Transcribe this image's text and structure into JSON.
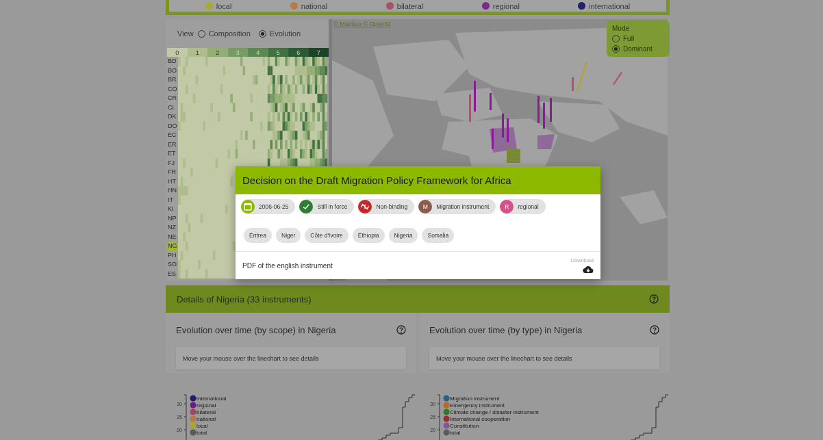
{
  "legend": [
    {
      "label": "local",
      "color": "#a8a832"
    },
    {
      "label": "national",
      "color": "#b87b45"
    },
    {
      "label": "bilateral",
      "color": "#a8506a"
    },
    {
      "label": "regional",
      "color": "#7a2a8a"
    },
    {
      "label": "international",
      "color": "#23236e"
    }
  ],
  "view": {
    "label": "View",
    "options": [
      {
        "label": "Composition",
        "selected": false
      },
      {
        "label": "Evolution",
        "selected": true
      }
    ]
  },
  "heatmap": {
    "scale": [
      {
        "label": "0",
        "color": "#c2c9a6"
      },
      {
        "label": "1",
        "color": "#adbd8c"
      },
      {
        "label": "2",
        "color": "#93ae74"
      },
      {
        "label": "3",
        "color": "#779b62"
      },
      {
        "label": "4",
        "color": "#5c8852"
      },
      {
        "label": "5",
        "color": "#407143"
      },
      {
        "label": "6",
        "color": "#2b5b34"
      },
      {
        "label": "7",
        "color": "#1b4325"
      }
    ],
    "rows": [
      {
        "code": "BD",
        "selected": false
      },
      {
        "code": "BO",
        "selected": false
      },
      {
        "code": "BR",
        "selected": false
      },
      {
        "code": "CO",
        "selected": false
      },
      {
        "code": "CR",
        "selected": false
      },
      {
        "code": "CI",
        "selected": false
      },
      {
        "code": "DK",
        "selected": false
      },
      {
        "code": "DO",
        "selected": false
      },
      {
        "code": "EC",
        "selected": false
      },
      {
        "code": "ER",
        "selected": false
      },
      {
        "code": "ET",
        "selected": false
      },
      {
        "code": "FJ",
        "selected": false
      },
      {
        "code": "FR",
        "selected": false
      },
      {
        "code": "HT",
        "selected": false
      },
      {
        "code": "HN",
        "selected": false
      },
      {
        "code": "IT",
        "selected": false
      },
      {
        "code": "KI",
        "selected": false
      },
      {
        "code": "NP",
        "selected": false
      },
      {
        "code": "NZ",
        "selected": false
      },
      {
        "code": "NE",
        "selected": false
      },
      {
        "code": "NG",
        "selected": true
      },
      {
        "code": "PH",
        "selected": false
      },
      {
        "code": "SO",
        "selected": false
      },
      {
        "code": "ES",
        "selected": false
      }
    ]
  },
  "map": {
    "attribution": "© Mapbox © OpenSt",
    "mode": {
      "label": "Mode",
      "options": [
        {
          "label": "Full",
          "selected": false
        },
        {
          "label": "Dominant",
          "selected": true
        }
      ]
    }
  },
  "dialog": {
    "title": "Decision on the Draft Migration Policy Framework for Africa",
    "chips": [
      {
        "kind": "date",
        "label": "2006-06-25",
        "color": "#8cb800"
      },
      {
        "kind": "status",
        "label": "Still in force",
        "color": "#2e7d32"
      },
      {
        "kind": "binding",
        "label": "Non-binding",
        "color": "#c62828"
      },
      {
        "kind": "letter",
        "letter": "M",
        "label": "Migration instrument",
        "color": "#8d5b4c"
      },
      {
        "kind": "letter",
        "letter": "R",
        "label": "regional",
        "color": "#d6508a"
      }
    ],
    "countries": [
      "Eritrea",
      "Niger",
      "Côte d'Ivoire",
      "Ethiopia",
      "Nigeria",
      "Somalia"
    ],
    "document": "PDF of the english instrument",
    "download": "Download"
  },
  "details": {
    "title": "Details of Nigeria (33 instruments)",
    "panels": [
      {
        "title": "Evolution over time (by scope) in Nigeria",
        "hint": "Move your mouse over the linechart to see details",
        "yticks": [
          "30",
          "25",
          "20"
        ],
        "legend": [
          {
            "label": "international",
            "color": "#1c1c6a"
          },
          {
            "label": "regional",
            "color": "#6a1e8a"
          },
          {
            "label": "bilateral",
            "color": "#a0456a"
          },
          {
            "label": "national",
            "color": "#b87a40"
          },
          {
            "label": "local",
            "color": "#aaaa22"
          },
          {
            "label": "total",
            "color": "#5a5a5a"
          }
        ]
      },
      {
        "title": "Evolution over time (by type) in Nigeria",
        "hint": "Move your mouse over the linechart to see details",
        "yticks": [
          "30",
          "25",
          "20"
        ],
        "legend": [
          {
            "label": "Migration instrument",
            "color": "#2a5f82"
          },
          {
            "label": "Emergency instrument",
            "color": "#b86a20"
          },
          {
            "label": "Climate change / disaster instrument",
            "color": "#2e7a2e"
          },
          {
            "label": "International cooperation",
            "color": "#a02828"
          },
          {
            "label": "Constitution",
            "color": "#7a5a9a"
          },
          {
            "label": "total",
            "color": "#5a5a5a"
          }
        ]
      }
    ]
  }
}
